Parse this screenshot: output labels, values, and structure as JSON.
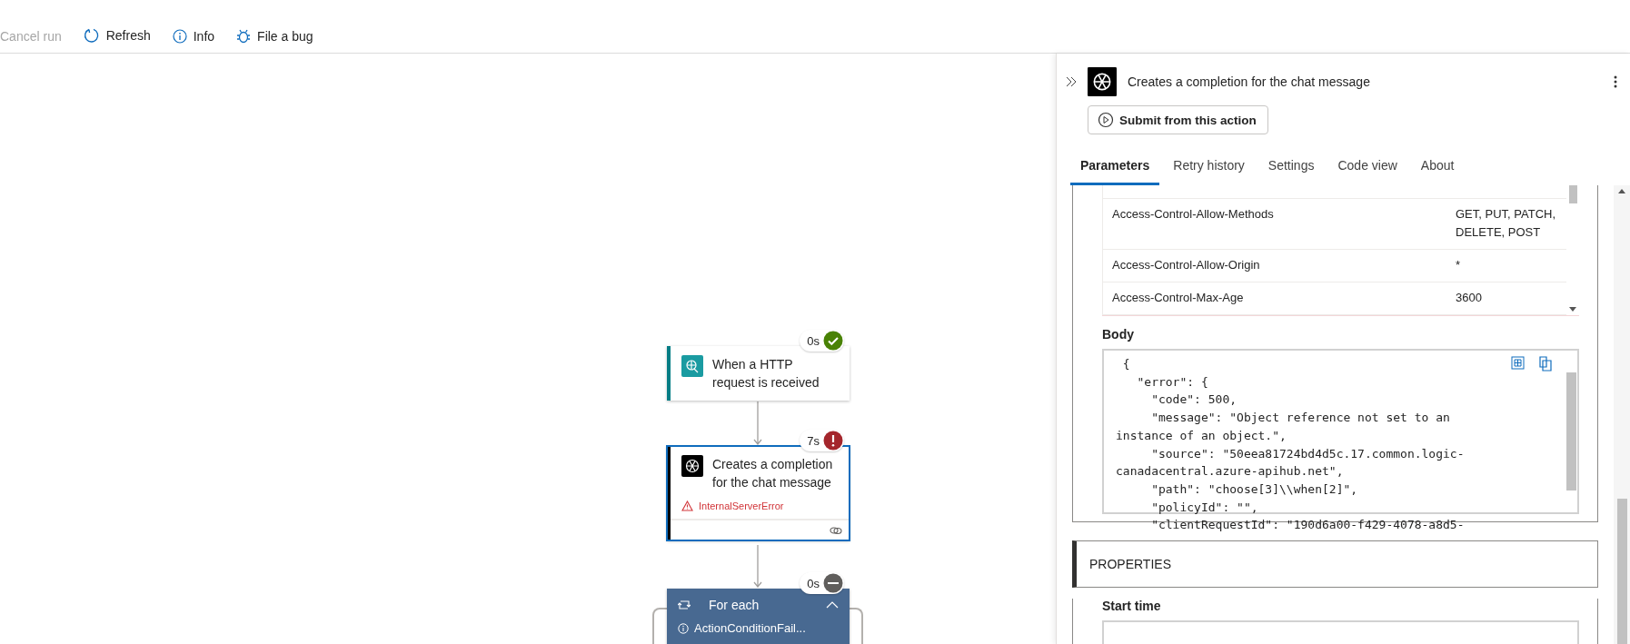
{
  "toolbar": [
    {
      "kind": "cancel",
      "label": "Cancel run",
      "disabled": true
    },
    {
      "kind": "refresh",
      "label": "Refresh",
      "disabled": false
    },
    {
      "kind": "info",
      "label": "Info",
      "disabled": false
    },
    {
      "kind": "bug",
      "label": "File a bug",
      "disabled": false
    }
  ],
  "flow": {
    "nodes": [
      {
        "kind": "trigger",
        "title": "When a HTTP request is received",
        "duration": "0s",
        "failed": false,
        "skipped": false,
        "selected": false
      },
      {
        "kind": "action",
        "title": "Creates a completion for the chat message",
        "duration": "7s",
        "failed": true,
        "skipped": false,
        "error": "InternalServerError",
        "selected": true
      },
      {
        "kind": "foreach",
        "title": "For each",
        "duration": "0s",
        "failed": false,
        "skipped": true,
        "error": "ActionConditionFail...",
        "selected": false
      }
    ]
  },
  "panel": {
    "title": "Creates a completion for the chat message",
    "submit_button": "Submit from this action",
    "tabs": [
      {
        "label": "Parameters",
        "selected": true
      },
      {
        "label": "Retry history",
        "selected": false
      },
      {
        "label": "Settings",
        "selected": false
      },
      {
        "label": "Code view",
        "selected": false
      },
      {
        "label": "About",
        "selected": false
      }
    ],
    "headers": [
      {
        "name": "Access-Control-Allow-Methods",
        "value": "GET, PUT, PATCH, DELETE, POST"
      },
      {
        "name": "Access-Control-Allow-Origin",
        "value": "*"
      },
      {
        "name": "Access-Control-Max-Age",
        "value": "3600"
      }
    ],
    "body_label": "Body",
    "body_lines": [
      " {",
      "   \"error\": {",
      "     \"code\": 500,",
      "     \"message\": \"Object reference not set to an",
      "instance of an object.\",",
      "     \"source\": \"50eea81724bd4d5c.17.common.logic-",
      "canadacentral.azure-apihub.net\",",
      "     \"path\": \"choose[3]\\\\when[2]\",",
      "     \"policyId\": \"\",",
      "     \"clientRequestId\": \"190d6a00-f429-4078-a8d5-"
    ],
    "properties_header": "PROPERTIES",
    "start_time_label": "Start time"
  }
}
